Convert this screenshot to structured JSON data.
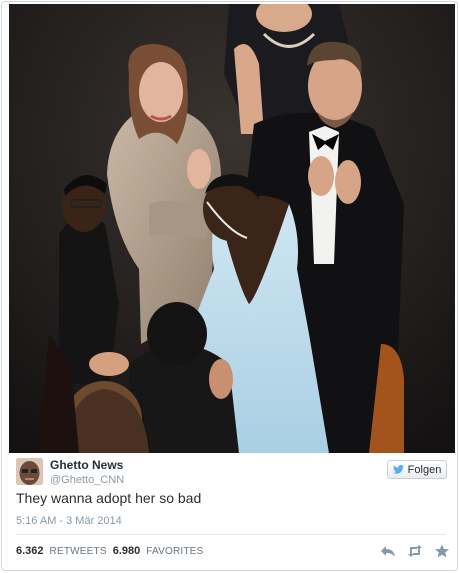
{
  "tweet": {
    "author_name": "Ghetto News",
    "author_handle": "@Ghetto_CNN",
    "text": "They wanna adopt her so bad",
    "timestamp": "5:16 AM - 3 Mär 2014",
    "follow_label": "Folgen"
  },
  "stats": {
    "retweets_count": "6.362",
    "retweets_label": "RETWEETS",
    "favorites_count": "6.980",
    "favorites_label": "FAVORITES"
  },
  "icons": {
    "reply": "reply-icon",
    "retweet": "retweet-icon",
    "favorite": "star-icon",
    "follow": "twitter-bird-icon"
  },
  "colors": {
    "accent": "#55acee",
    "text": "#292f33",
    "muted": "#8899a6"
  }
}
